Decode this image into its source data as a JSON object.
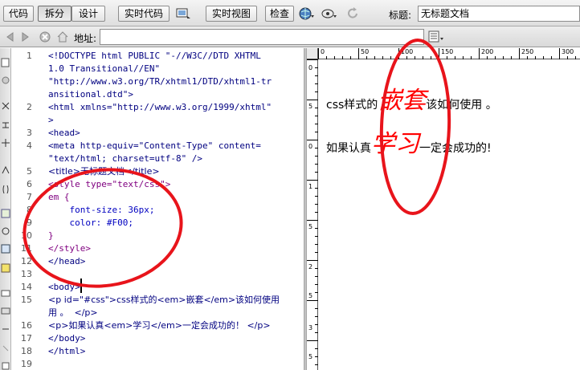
{
  "toolbar": {
    "code_label": "代码",
    "split_label": "拆分",
    "design_label": "设计",
    "live_code_label": "实时代码",
    "live_view_label": "实时视图",
    "inspect_label": "检查",
    "title_label": "标题:",
    "title_value": "无标题文档"
  },
  "addressbar": {
    "label": "地址:",
    "value": ""
  },
  "code": {
    "lines": [
      {
        "n": "1",
        "text": "<!DOCTYPE html PUBLIC \"-//W3C//DTD XHTML"
      },
      {
        "n": "",
        "text": "1.0 Transitional//EN\""
      },
      {
        "n": "",
        "text": "\"http://www.w3.org/TR/xhtml1/DTD/xhtml1-tr"
      },
      {
        "n": "",
        "text": "ansitional.dtd\">"
      },
      {
        "n": "2",
        "text": "<html xmlns=\"http://www.w3.org/1999/xhtml\""
      },
      {
        "n": "",
        "text": ">"
      },
      {
        "n": "3",
        "text": "<head>"
      },
      {
        "n": "4",
        "text": "<meta http-equiv=\"Content-Type\" content="
      },
      {
        "n": "",
        "text": "\"text/html; charset=utf-8\" />"
      },
      {
        "n": "5",
        "text": "<title>无标题文档</title>"
      },
      {
        "n": "6",
        "text": "<style type=\"text/css\">"
      },
      {
        "n": "7",
        "text": "em {"
      },
      {
        "n": "8",
        "text": "    font-size: 36px;"
      },
      {
        "n": "9",
        "text": "    color: #F00;"
      },
      {
        "n": "10",
        "text": "}"
      },
      {
        "n": "11",
        "text": "</style>"
      },
      {
        "n": "12",
        "text": "</head>"
      },
      {
        "n": "13",
        "text": ""
      },
      {
        "n": "14",
        "text": "<body>"
      },
      {
        "n": "15",
        "text": "<p id=\"#css\">css样式的<em>嵌套</em>该如何使用"
      },
      {
        "n": "",
        "text": "用 。  </p>"
      },
      {
        "n": "16",
        "text": "<p>如果认真<em>学习</em>一定会成功的！ </p>"
      },
      {
        "n": "17",
        "text": "</body>"
      },
      {
        "n": "18",
        "text": "</html>"
      },
      {
        "n": "19",
        "text": ""
      }
    ]
  },
  "ruler": {
    "h_labels": [
      "0",
      "50",
      "100",
      "150",
      "200",
      "250",
      "300"
    ],
    "v_labels": [
      "0",
      "5",
      "0",
      "1",
      "5",
      "2",
      "5",
      "3",
      "5"
    ]
  },
  "design": {
    "p1_before": "css样式的",
    "p1_em": "嵌套",
    "p1_after": "该如何使用 。",
    "p2_before": "如果认真",
    "p2_em": "学习",
    "p2_after": "一定会成功的!"
  },
  "colors": {
    "annotation": "#e8141b",
    "em_color": "#ff0000"
  }
}
